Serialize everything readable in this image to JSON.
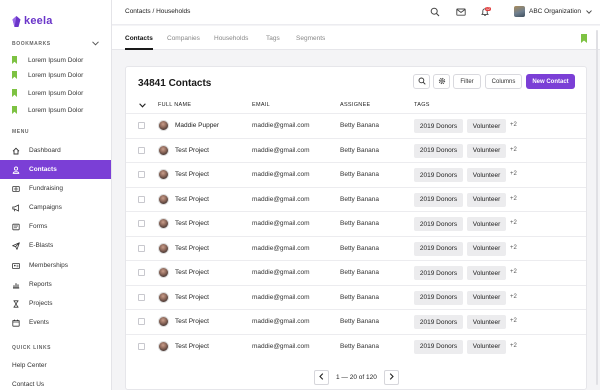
{
  "app": {
    "logo_text": "keela",
    "brand_color": "#7b3fd6",
    "bookmark_color": "#7dc242"
  },
  "sidebar": {
    "bookmarks_title": "BOOKMARKS",
    "bookmarks": [
      {
        "label": "Lorem Ipsum Dolor"
      },
      {
        "label": "Lorem Ipsum Dolor"
      },
      {
        "label": "Lorem Ipsum Dolor"
      },
      {
        "label": "Lorem Ipsum Dolor"
      }
    ],
    "menu_title": "MENU",
    "items": [
      {
        "label": "Dashboard",
        "icon": "dashboard-icon"
      },
      {
        "label": "Contacts",
        "icon": "person-icon",
        "active": true
      },
      {
        "label": "Fundraising",
        "icon": "dollar-icon"
      },
      {
        "label": "Campaigns",
        "icon": "megaphone-icon"
      },
      {
        "label": "Forms",
        "icon": "form-icon"
      },
      {
        "label": "E-Blasts",
        "icon": "send-icon"
      },
      {
        "label": "Memberships",
        "icon": "id-card-icon"
      },
      {
        "label": "Reports",
        "icon": "chart-icon"
      },
      {
        "label": "Projects",
        "icon": "hourglass-icon"
      },
      {
        "label": "Events",
        "icon": "calendar-icon"
      }
    ],
    "quick_links_title": "QUICK LINKS",
    "quick_links": [
      {
        "label": "Help Center"
      },
      {
        "label": "Contact Us"
      }
    ]
  },
  "header": {
    "breadcrumb": "Contacts / Households",
    "notification_count": "12",
    "org_name": "ABC Organization"
  },
  "tabs": [
    {
      "label": "Contacts",
      "active": true
    },
    {
      "label": "Companies"
    },
    {
      "label": "Households"
    },
    {
      "label": "Tags"
    },
    {
      "label": "Segments"
    }
  ],
  "main": {
    "title": "34841 Contacts",
    "filter_label": "Filter",
    "columns_label": "Columns",
    "new_contact_label": "New Contact",
    "columns": {
      "name": "FULL NAME",
      "email": "EMAIL",
      "assignee": "ASSIGNEE",
      "tags": "TAGS"
    },
    "rows": [
      {
        "name": "Maddie Pupper",
        "email": "maddie@gmail.com",
        "assignee": "Betty Banana",
        "tag1": "2019 Donors",
        "tag2": "Volunteer",
        "more": "+2"
      },
      {
        "name": "Test Project",
        "email": "maddie@gmail.com",
        "assignee": "Betty Banana",
        "tag1": "2019 Donors",
        "tag2": "Volunteer",
        "more": "+2"
      },
      {
        "name": "Test Project",
        "email": "maddie@gmail.com",
        "assignee": "Betty Banana",
        "tag1": "2019 Donors",
        "tag2": "Volunteer",
        "more": "+2"
      },
      {
        "name": "Test Project",
        "email": "maddie@gmail.com",
        "assignee": "Betty Banana",
        "tag1": "2019 Donors",
        "tag2": "Volunteer",
        "more": "+2"
      },
      {
        "name": "Test Project",
        "email": "maddie@gmail.com",
        "assignee": "Betty Banana",
        "tag1": "2019 Donors",
        "tag2": "Volunteer",
        "more": "+2"
      },
      {
        "name": "Test Project",
        "email": "maddie@gmail.com",
        "assignee": "Betty Banana",
        "tag1": "2019 Donors",
        "tag2": "Volunteer",
        "more": "+2"
      },
      {
        "name": "Test Project",
        "email": "maddie@gmail.com",
        "assignee": "Betty Banana",
        "tag1": "2019 Donors",
        "tag2": "Volunteer",
        "more": "+2"
      },
      {
        "name": "Test Project",
        "email": "maddie@gmail.com",
        "assignee": "Betty Banana",
        "tag1": "2019 Donors",
        "tag2": "Volunteer",
        "more": "+2"
      },
      {
        "name": "Test Project",
        "email": "maddie@gmail.com",
        "assignee": "Betty Banana",
        "tag1": "2019 Donors",
        "tag2": "Volunteer",
        "more": "+2"
      },
      {
        "name": "Test Project",
        "email": "maddie@gmail.com",
        "assignee": "Betty Banana",
        "tag1": "2019 Donors",
        "tag2": "Volunteer",
        "more": "+2"
      }
    ]
  },
  "pagination": {
    "text": "1 — 20 of 120"
  }
}
